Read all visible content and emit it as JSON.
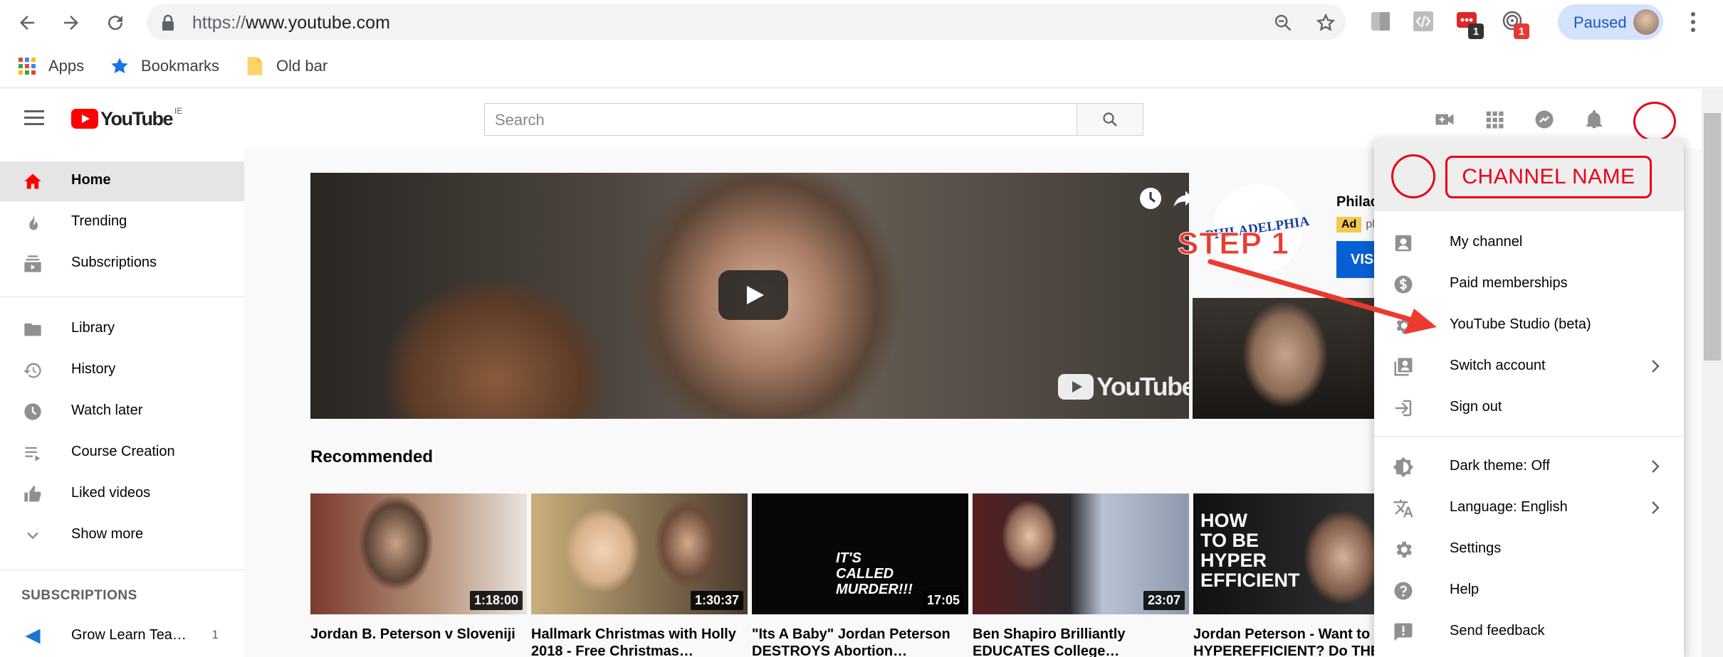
{
  "browser": {
    "url_prefix": "https://",
    "url_host": "www.youtube.com",
    "profile_label": "Paused",
    "extension_badges": [
      "1",
      "1"
    ],
    "bookmarks": [
      "Apps",
      "Bookmarks",
      "Old bar"
    ]
  },
  "youtube": {
    "logo_text": "YouTube",
    "logo_region": "IE",
    "search_placeholder": "Search"
  },
  "sidebar": {
    "items": [
      {
        "label": "Home",
        "icon": "home-icon",
        "active": true
      },
      {
        "label": "Trending",
        "icon": "trending-icon"
      },
      {
        "label": "Subscriptions",
        "icon": "subscriptions-icon"
      },
      {
        "label": "Library",
        "icon": "library-icon"
      },
      {
        "label": "History",
        "icon": "history-icon"
      },
      {
        "label": "Watch later",
        "icon": "watch-later-icon"
      },
      {
        "label": "Course Creation",
        "icon": "playlist-icon"
      },
      {
        "label": "Liked videos",
        "icon": "thumbs-up-icon"
      },
      {
        "label": "Show more",
        "icon": "chevron-down-icon"
      }
    ],
    "subscriptions_header": "SUBSCRIPTIONS",
    "subscriptions": [
      {
        "label": "Grow Learn Tea…",
        "count": "1"
      }
    ]
  },
  "main": {
    "hero_watermark": "YouTube",
    "ad": {
      "logo_text": "PHILADELPHIA",
      "name": "Philac",
      "badge": "Ad",
      "sub": "pl",
      "button": "VIS"
    },
    "recommended_title": "Recommended",
    "videos": [
      {
        "title": "Jordan B. Peterson v Sloveniji",
        "duration": "1:18:00",
        "overlay": ""
      },
      {
        "title": "Hallmark Christmas with Holly 2018 - Free Christmas…",
        "duration": "1:30:37",
        "overlay": ""
      },
      {
        "title": "\"Its A Baby\" Jordan Peterson DESTROYS Abortion…",
        "duration": "17:05",
        "overlay": "IT'S CALLED MURDER!!!"
      },
      {
        "title": "Ben Shapiro Brilliantly EDUCATES College…",
        "duration": "23:07",
        "overlay": ""
      },
      {
        "title": "Jordan Peterson - Want to be HYPEREFFICIENT? Do THES",
        "duration": "",
        "overlay": "HOW TO BE HYPER EFFICIENT"
      }
    ]
  },
  "account_menu": {
    "channel_name": "CHANNEL NAME",
    "items": [
      {
        "label": "My channel",
        "icon": "account-box-icon",
        "chevron": false
      },
      {
        "label": "Paid memberships",
        "icon": "dollar-icon",
        "chevron": false
      },
      {
        "label": "YouTube Studio (beta)",
        "icon": "gear-icon",
        "chevron": false
      },
      {
        "label": "Switch account",
        "icon": "switch-account-icon",
        "chevron": true
      },
      {
        "label": "Sign out",
        "icon": "sign-out-icon",
        "chevron": false
      },
      {
        "label": "Dark theme: Off",
        "icon": "dark-theme-icon",
        "chevron": true
      },
      {
        "label": "Language: English",
        "icon": "translate-icon",
        "chevron": true
      },
      {
        "label": "Settings",
        "icon": "gear-icon",
        "chevron": false
      },
      {
        "label": "Help",
        "icon": "help-icon",
        "chevron": false
      },
      {
        "label": "Send feedback",
        "icon": "feedback-icon",
        "chevron": false
      }
    ]
  },
  "annotation": {
    "step_label": "STEP 1",
    "color": "#ec3a2e"
  },
  "colors": {
    "youtube_red": "#ff0000",
    "annotation_red": "#e8001a",
    "link_blue": "#065fd4"
  }
}
